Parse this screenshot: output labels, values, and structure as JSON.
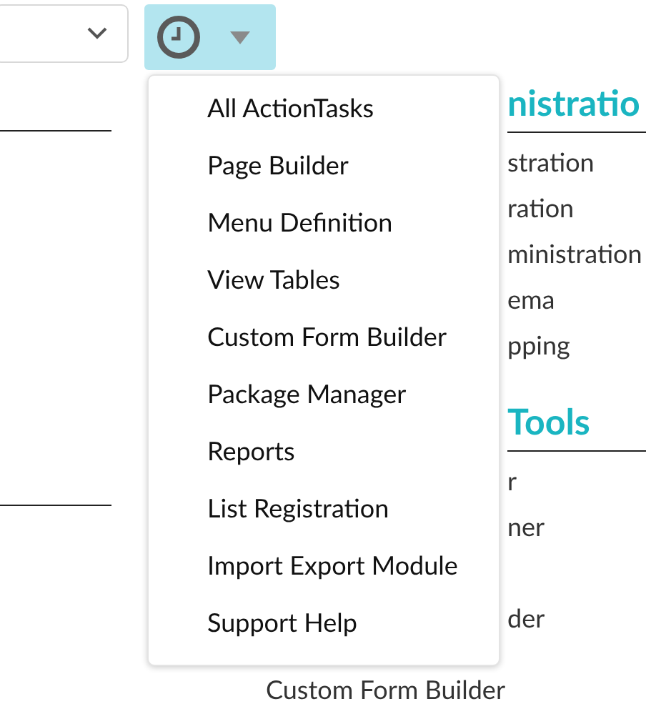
{
  "menu": {
    "items": [
      "All ActionTasks",
      "Page Builder",
      "Menu Definition",
      "View Tables",
      "Custom Form Builder",
      "Package Manager",
      "Reports",
      "List Registration",
      "Import Export Module",
      "Support Help"
    ]
  },
  "background_sections": [
    {
      "heading": "nistratio",
      "items": [
        "stration",
        "ration",
        "ministration",
        "ema",
        "pping"
      ]
    },
    {
      "heading": "Tools",
      "items": [
        "r",
        "ner",
        "der"
      ]
    }
  ],
  "background_trailing_item": "Custom Form Builder"
}
